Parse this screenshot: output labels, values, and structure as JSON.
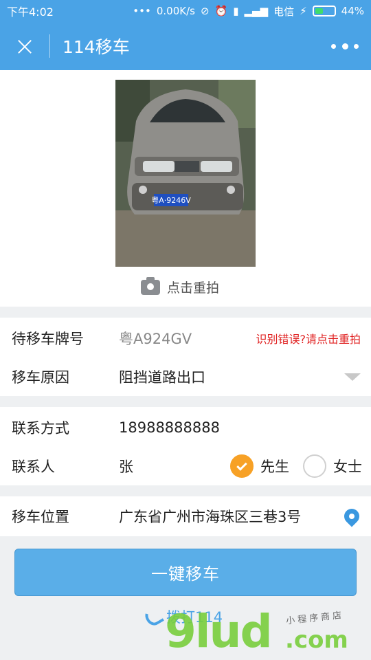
{
  "status_bar": {
    "time": "下午4:02",
    "dots": "•••",
    "network_speed": "0.00K/s",
    "carrier": "电信",
    "battery_percent": "44%",
    "battery_level": 0.44,
    "icons": [
      "mute-icon",
      "alarm-icon",
      "signal-icon",
      "4g-icon",
      "charging-icon",
      "battery-icon"
    ]
  },
  "nav": {
    "close_icon": "×",
    "title": "114移车"
  },
  "photo": {
    "plate_text": "粤A·9246V",
    "retake_label": "点击重拍"
  },
  "form": {
    "plate": {
      "label": "待移车牌号",
      "value": "粤A924GV",
      "hint": "识别错误?请点击重拍"
    },
    "reason": {
      "label": "移车原因",
      "value": "阻挡道路出口"
    },
    "contact": {
      "label": "联系方式",
      "value": "18988888888"
    },
    "person": {
      "label": "联系人",
      "value": "张",
      "options": [
        {
          "label": "先生",
          "checked": true
        },
        {
          "label": "女士",
          "checked": false
        }
      ]
    },
    "location": {
      "label": "移车位置",
      "value": "广东省广州市海珠区三巷3号"
    }
  },
  "actions": {
    "main_button": "一键移车",
    "call_label": "拨打114"
  },
  "watermark": {
    "main": "9lud",
    "com": ".com",
    "sub": "小程序商店"
  },
  "colors": {
    "brand": "#4aa3e6",
    "button": "#5aaee8",
    "error": "#e02020",
    "radio_checked": "#f7a126"
  }
}
